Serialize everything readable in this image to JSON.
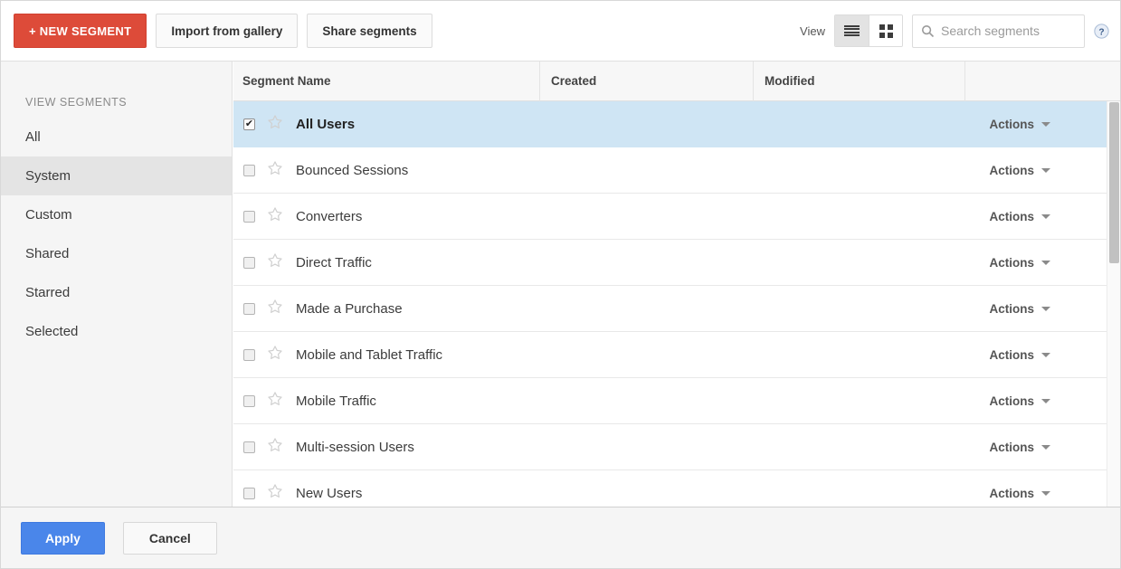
{
  "toolbar": {
    "new_segment_label": "+ NEW SEGMENT",
    "import_label": "Import from gallery",
    "share_label": "Share segments",
    "view_label": "View",
    "view_modes": [
      "list",
      "grid"
    ],
    "active_view_mode": "list",
    "search": {
      "value": "",
      "placeholder": "Search segments"
    },
    "help_icon": "help-circle-icon",
    "accent_color": "#dd4b39"
  },
  "sidebar": {
    "heading": "VIEW SEGMENTS",
    "active_item": "System",
    "items": [
      {
        "label": "All"
      },
      {
        "label": "System"
      },
      {
        "label": "Custom"
      },
      {
        "label": "Shared"
      },
      {
        "label": "Starred"
      },
      {
        "label": "Selected"
      }
    ]
  },
  "table": {
    "columns": [
      {
        "label": "Segment Name"
      },
      {
        "label": "Created"
      },
      {
        "label": "Modified"
      },
      {
        "label": ""
      }
    ],
    "action_label": "Actions",
    "rows": [
      {
        "name": "All Users",
        "checked": true,
        "starred": false,
        "created": "",
        "modified": "",
        "selected": true
      },
      {
        "name": "Bounced Sessions",
        "checked": false,
        "starred": false,
        "created": "",
        "modified": "",
        "selected": false
      },
      {
        "name": "Converters",
        "checked": false,
        "starred": false,
        "created": "",
        "modified": "",
        "selected": false
      },
      {
        "name": "Direct Traffic",
        "checked": false,
        "starred": false,
        "created": "",
        "modified": "",
        "selected": false
      },
      {
        "name": "Made a Purchase",
        "checked": false,
        "starred": false,
        "created": "",
        "modified": "",
        "selected": false
      },
      {
        "name": "Mobile and Tablet Traffic",
        "checked": false,
        "starred": false,
        "created": "",
        "modified": "",
        "selected": false
      },
      {
        "name": "Mobile Traffic",
        "checked": false,
        "starred": false,
        "created": "",
        "modified": "",
        "selected": false
      },
      {
        "name": "Multi-session Users",
        "checked": false,
        "starred": false,
        "created": "",
        "modified": "",
        "selected": false
      },
      {
        "name": "New Users",
        "checked": false,
        "starred": false,
        "created": "",
        "modified": "",
        "selected": false
      }
    ]
  },
  "footer": {
    "apply_label": "Apply",
    "cancel_label": "Cancel",
    "apply_color": "#4a86ea"
  }
}
